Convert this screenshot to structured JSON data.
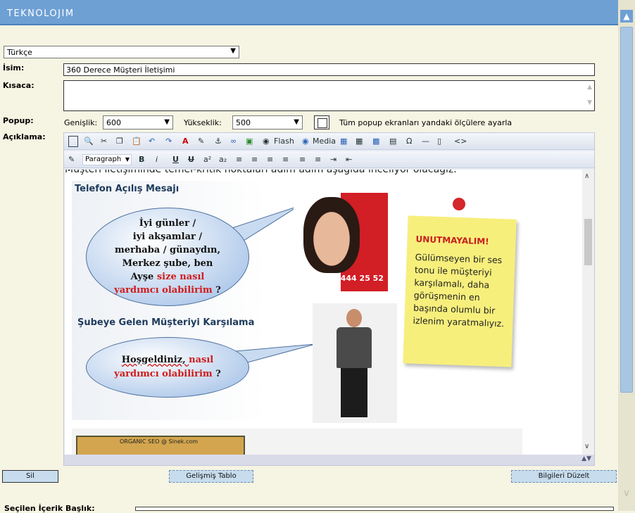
{
  "header": {
    "title": "TEKNOLOJIM"
  },
  "language": {
    "selected": "Türkçe"
  },
  "form": {
    "name_label": "İsim:",
    "name_value": "360 Derece Müşteri İletişimi",
    "short_label": "Kısaca:",
    "popup_label": "Popup:",
    "width_label": "Genişlik:",
    "width_value": "600",
    "height_label": "Yükseklik:",
    "height_value": "500",
    "apply_all_label": "Tüm popup ekranları yandaki ölçülere ayarla",
    "description_label": "Açıklama:"
  },
  "editor": {
    "toolbar1": {
      "flash": "Flash",
      "media": "Media"
    },
    "toolbar2": {
      "paragraph": "Paragraph",
      "bold": "B",
      "italic": "i",
      "underline": "U",
      "strike": "U",
      "sup": "a²",
      "sub": "a₂"
    },
    "content": {
      "intro": "Müşteri iletişiminde temel-kritik noktaları adım adım aşağıda inceliyor olacağız.",
      "heading1": "Telefon Açılış Mesajı",
      "bubble1": [
        "İyi günler /",
        "iyi akşamlar /",
        "merhaba / günaydın,",
        "Merkez şube, ben",
        "Ayşe "
      ],
      "bubble1_red1": "size nasıl",
      "bubble1_red2": "yardımcı olabilirim",
      "bubble1_end": " ?",
      "phone_number": "444 25 52",
      "note_title": "UNUTMAYALIM!",
      "note_body": "Gülümseyen bir ses tonu ile müşteriyi karşılamalı, daha görüşmenin en başında olumlu bir izlenim yaratmalıyız.",
      "heading2": "Şubeye Gelen Müşteriyi Karşılama",
      "bubble2_start": "Hoşgeldiniz, ",
      "bubble2_red1": "nasıl",
      "bubble2_red2": "yardımcı olabilirim",
      "bubble2_end": " ?",
      "strip_text": "ORGANIC SEO @ Sinek.com"
    }
  },
  "buttons": {
    "delete": "Sil",
    "advanced_table": "Gelişmiş Tablo",
    "update_info": "Bilgileri Düzelt"
  },
  "footer": {
    "selected_content_title": "Seçilen İçerik Başlık:"
  },
  "colors": {
    "header": "#6ea0d4",
    "background": "#f6f4e2",
    "accent_red": "#d11a1a",
    "note": "#f7ef7c"
  }
}
